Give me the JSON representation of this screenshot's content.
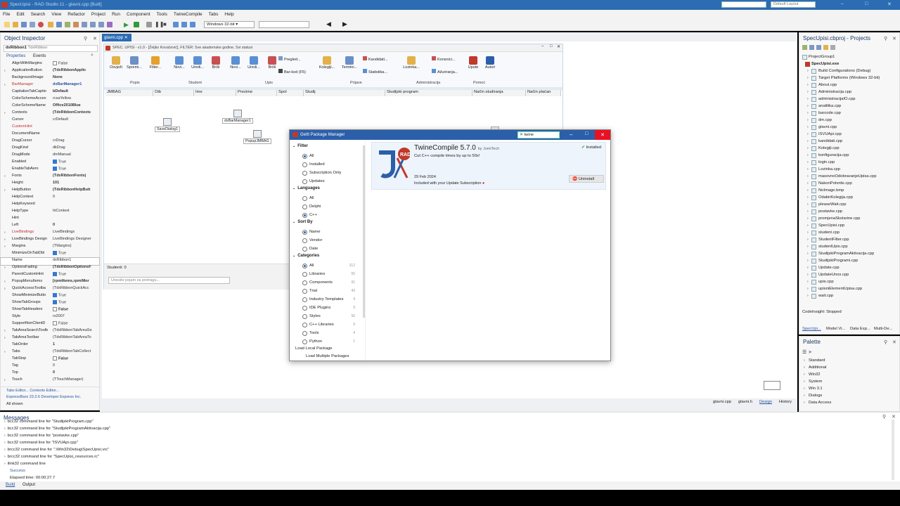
{
  "window": {
    "title": "SpecUpisi - RAD Studio 11 - glavni.cpp [Built]",
    "search_placeholder": "",
    "layout": "Default Layout"
  },
  "menu": [
    "File",
    "Edit",
    "Search",
    "View",
    "Refactor",
    "Project",
    "Run",
    "Component",
    "Tools",
    "TwineCompile",
    "Tabs",
    "Help"
  ],
  "toolbar": {
    "platform": "Windows 32-bit",
    "config": ""
  },
  "object_inspector": {
    "title": "Object Inspector",
    "component": "dxRibbon1",
    "component_type": "TdxRibbon",
    "tabs": [
      "Properties",
      "Events"
    ],
    "rows": [
      {
        "n": "AlignWithMargins",
        "v": "False",
        "k": "chk"
      },
      {
        "n": "ApplicationButton",
        "v": "(TdxRibbonApplic",
        "k": "bold",
        "e": true
      },
      {
        "n": "BackgroundImage",
        "v": "None",
        "k": "bold"
      },
      {
        "n": "BarManager",
        "v": "dxBarManager1",
        "k": "bold",
        "e": true,
        "r": true
      },
      {
        "n": "CapitalizeTabCaptio",
        "v": "bDefault",
        "k": "bold"
      },
      {
        "n": "ColorSchemeAccen",
        "v": "rcsaYellow"
      },
      {
        "n": "ColorSchemeName",
        "v": "Office2010Blue",
        "k": "bold"
      },
      {
        "n": "Contexts",
        "v": "(TdxRibbonContexts",
        "k": "bold",
        "e": true
      },
      {
        "n": "Cursor",
        "v": "crDefault"
      },
      {
        "n": "CustomHint",
        "v": "",
        "r": true
      },
      {
        "n": "DocumentName",
        "v": ""
      },
      {
        "n": "DragCursor",
        "v": "crDrag"
      },
      {
        "n": "DragKind",
        "v": "dkDrag"
      },
      {
        "n": "DragMode",
        "v": "dmManual"
      },
      {
        "n": "Enabled",
        "v": "True",
        "k": "chkon"
      },
      {
        "n": "EnableTabAero",
        "v": "True",
        "k": "chkon"
      },
      {
        "n": "Fonts",
        "v": "(TdxRibbonFonts)",
        "k": "bold",
        "e": true
      },
      {
        "n": "Height",
        "v": "101",
        "k": "bold"
      },
      {
        "n": "HelpButton",
        "v": "(TdxRibbonHelpButt",
        "k": "bold",
        "e": true
      },
      {
        "n": "HelpContext",
        "v": "0"
      },
      {
        "n": "HelpKeyword",
        "v": ""
      },
      {
        "n": "HelpType",
        "v": "htContext"
      },
      {
        "n": "Hint",
        "v": ""
      },
      {
        "n": "Left",
        "v": "0",
        "k": "bold"
      },
      {
        "n": "LiveBindings",
        "v": "LiveBindings",
        "e": true,
        "r": true
      },
      {
        "n": "LiveBindings Design",
        "v": "LiveBindings Designer",
        "e": true
      },
      {
        "n": "Margins",
        "v": "(TMargins)",
        "e": true
      },
      {
        "n": "MinimizeOnTabDbl",
        "v": "True",
        "k": "chkon"
      },
      {
        "n": "Name",
        "v": "dxRibbon1",
        "sel": true
      },
      {
        "n": "OptionsFading",
        "v": "(TdxRibbonOptionsF",
        "k": "bold",
        "e": true
      },
      {
        "n": "ParentCustomHint",
        "v": "True",
        "k": "chkon"
      },
      {
        "n": "PopupMenuItems",
        "v": "[rpmiItems,rpmiMor",
        "k": "bold",
        "e": true
      },
      {
        "n": "QuickAccessToolba",
        "v": "(TdxRibbonQuickAcc",
        "e": true
      },
      {
        "n": "ShowMinimizeButto",
        "v": "True",
        "k": "chkon"
      },
      {
        "n": "ShowTabGroups",
        "v": "True",
        "k": "chkon"
      },
      {
        "n": "ShowTabHeaders",
        "v": "False",
        "k": "chkb"
      },
      {
        "n": "Style",
        "v": "rs2007"
      },
      {
        "n": "SupportNonClientD",
        "v": "False",
        "k": "chk"
      },
      {
        "n": "TabAreaSearchToolb",
        "v": "(TdxRibbonTabAreaSe",
        "e": true
      },
      {
        "n": "TabAreaToolbar",
        "v": "(TdxRibbonTabAreaTo",
        "e": true
      },
      {
        "n": "TabOrder",
        "v": "1",
        "k": "bold"
      },
      {
        "n": "Tabs",
        "v": "(TdxRibbonTabCollect",
        "e": true
      },
      {
        "n": "TabStop",
        "v": "False",
        "k": "chkb"
      },
      {
        "n": "Tag",
        "v": "0"
      },
      {
        "n": "Top",
        "v": "0",
        "k": "bold"
      },
      {
        "n": "Touch",
        "v": "(TTouchManager)",
        "e": true
      }
    ],
    "footer_links": "Tabs Editor...    Contexts Editor...",
    "footer_info": "ExpressBars 23.2.6    Developer Express Inc.",
    "footer_status": "All shown"
  },
  "editor_tab": "glavni.cpp",
  "form": {
    "title": "SPEC. UPISI - v1.0 - [Željko Kovačević], FILTER: Sve akademske godine, Svi statusi",
    "buttons": [
      "Osvježi",
      "Spremi...",
      "Filter...",
      "Novi...",
      "Uredi...",
      "Briši",
      "Novi...",
      "Uredi...",
      "Briši",
      "Pregled...",
      "Bar-kod (F5)",
      "Kolegiji...",
      "Termini...",
      "Kandidati...",
      "Statistika...",
      "Lozinka...",
      "Konsnici...",
      "Ažuriranja...",
      "Upute",
      "Autori"
    ],
    "groups": [
      "Popis",
      "Student",
      "Upis",
      "Prijave",
      "Administracija",
      "Pomoć"
    ],
    "columns": [
      "JMBAG",
      "Oib",
      "Ime",
      "Prezime",
      "Spol",
      "Studij",
      "Studijski program",
      "Način studiranja",
      "Način plaćan"
    ],
    "components": [
      "SaveDialog1",
      "dxBarManager1",
      "PopupJMBAG"
    ],
    "status": "Studenti: 0",
    "search_placeholder": "Unesite pojam za pretragu..."
  },
  "getit": {
    "title": "GetIt Package Manager",
    "search": "twine",
    "filter_title": "Filter",
    "filter": [
      "All",
      "Installed",
      "Subscription Only",
      "Updates"
    ],
    "languages_title": "Languages",
    "languages": [
      "All",
      "Delphi",
      "C++"
    ],
    "sort_title": "Sort By",
    "sort": [
      "Name",
      "Vendor",
      "Date"
    ],
    "categories_title": "Categories",
    "categories": [
      {
        "n": "All",
        "c": "312"
      },
      {
        "n": "Libraries",
        "c": "55"
      },
      {
        "n": "Components",
        "c": "91"
      },
      {
        "n": "Trial",
        "c": "43"
      },
      {
        "n": "Industry Templates",
        "c": "4"
      },
      {
        "n": "IDE Plugins",
        "c": "9"
      },
      {
        "n": "Styles",
        "c": "56"
      },
      {
        "n": "C++ Libraries",
        "c": "9"
      },
      {
        "n": "Tools",
        "c": "4"
      },
      {
        "n": "Python",
        "c": "1"
      }
    ],
    "load_local": "Load Local Package",
    "load_multiple": "Load Multiple Packages",
    "package": {
      "name": "TwineCompile 5.7.0",
      "vendor": "by JomiTech",
      "desc": "Cut C++ compile times by up to 50x!",
      "date": "29 Feb 2024",
      "note": "Included with your Update Subscription",
      "status": "Installed",
      "action": "Uninstall"
    }
  },
  "projects": {
    "title": "SpecUpisi.cbproj - Projects",
    "group": "ProjectGroup1",
    "exe": "SpecUpisi.exe",
    "items": [
      "Build Configurations (Debug)",
      "Target Platforms (Windows 32-bit)",
      "About.cpp",
      "Administracija.cpp",
      "administracijaIO.cpp",
      "analitika.cpp",
      "barcode.cpp",
      "dm.cpp",
      "glavni.cpp",
      "ISVUApi.cpp",
      "kandidati.cpp",
      "Kolegiji.cpp",
      "konfiguracija.cpp",
      "login.cpp",
      "Lozinka.cpp",
      "masovnoOdobravanjeUpisa.cpp",
      "NakonPotvrde.cpp",
      "NoImage.bmp",
      "OdabirKolegija.cpp",
      "pleaseWait.cpp",
      "postavke.cpp",
      "promjenaSkolarine.cpp",
      "SpecUpisi.cpp",
      "student.cpp",
      "StudentFilter.cpp",
      "studentUpis.cpp",
      "StudijskiProgramAktivacija.cpp",
      "StudijskiProgrami.cpp",
      "Update.cpp",
      "UpdateUnos.cpp",
      "upis.cpp",
      "upisniElementUpisa.cpp",
      "wait.cpp"
    ],
    "codeinsight": "CodeInsight: Stopped",
    "tabs": [
      "SpecUpi...",
      "Model Vi...",
      "Data Exp...",
      "Multi-De..."
    ]
  },
  "palette": {
    "title": "Palette",
    "items": [
      "Standard",
      "Additional",
      "Win32",
      "System",
      "Win 3.1",
      "Dialogs",
      "Data Access"
    ]
  },
  "design_tabs": [
    "glavni.cpp",
    "glavni.h",
    "Design",
    "History"
  ],
  "messages": {
    "title": "Messages",
    "lines": [
      "bcc32 command line for \"StudijskiProgram.cpp\"",
      "bcc32 command line for \"StudijskiProgramAktivacija.cpp\"",
      "bcc32 command line for \"postavke.cpp\"",
      "bcc32 command line for \"ISVUApi.cpp\"",
      "brcc32 command line for \".\\Win32\\Debug\\SpecUpisi.vrc\"",
      "brcc32 command line for \"SpecUpisi_resources.rc\"",
      "ilink32 command line"
    ],
    "success": "Success",
    "elapsed": "Elapsed time: 00:00:27.7",
    "tabs": [
      "Build",
      "Output"
    ]
  }
}
